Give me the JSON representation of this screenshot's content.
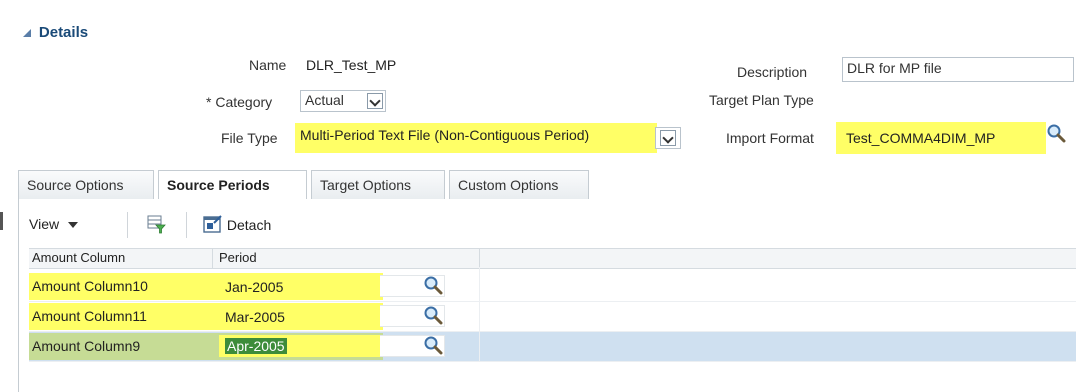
{
  "details": {
    "title": "Details",
    "name_label": "Name",
    "name_value": "DLR_Test_MP",
    "category_label": "* Category",
    "category_value": "Actual",
    "file_type_label": "File Type",
    "file_type_value": "Multi-Period Text File (Non-Contiguous Period)",
    "description_label": "Description",
    "description_value": "DLR for MP file",
    "target_plan_type_label": "Target Plan Type",
    "import_format_label": "Import Format",
    "import_format_value": "Test_COMMA4DIM_MP"
  },
  "tabs": [
    "Source Options",
    "Source Periods",
    "Target Options",
    "Custom Options"
  ],
  "active_tab": "Source Periods",
  "toolbar": {
    "view_label": "View",
    "detach_label": "Detach"
  },
  "grid": {
    "columns": [
      "Amount Column",
      "Period"
    ],
    "rows": [
      {
        "amount_column": "Amount Column10",
        "period": "Jan-2005",
        "selected": false
      },
      {
        "amount_column": "Amount Column11",
        "period": "Mar-2005",
        "selected": false
      },
      {
        "amount_column": "Amount Column9",
        "period": "Apr-2005",
        "selected": true
      }
    ]
  },
  "colors": {
    "highlight": "#ffff66",
    "selected_row": "#cfe0f0",
    "section_title": "#1a4a78"
  },
  "icons": [
    "collapse-triangle-icon",
    "dropdown-chevron-icon",
    "magnifier-icon",
    "filter-icon",
    "detach-icon"
  ]
}
